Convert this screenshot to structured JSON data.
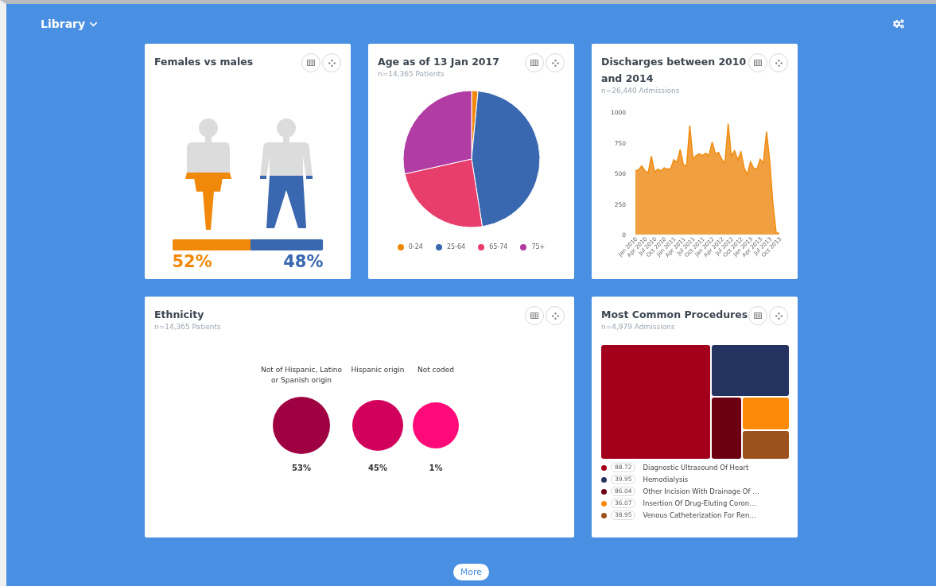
{
  "header": {
    "title": "Library"
  },
  "gender": {
    "title": "Females vs males",
    "groups": [
      {
        "kind": "female",
        "percent": "52%",
        "level": 0.52,
        "color": "#f0880a"
      },
      {
        "kind": "male",
        "percent": "48%",
        "level": 0.48,
        "color": "#3a68b0"
      }
    ]
  },
  "age": {
    "title": "Age as of 13 Jan 2017",
    "subtitle": "n=14,365 Patients",
    "chart_data": {
      "type": "pie",
      "categories": [
        "0-24",
        "25-64",
        "65-74",
        "75+"
      ],
      "series": [
        {
          "values": [
            1.5,
            46,
            24,
            28.5
          ]
        }
      ],
      "colors": [
        "#f0880a",
        "#3a68b0",
        "#e83e6c",
        "#b03ca4"
      ]
    }
  },
  "discharges": {
    "title": "Discharges between 2010 and 2014",
    "subtitle": "n=26,440 Admissions",
    "chart_data": {
      "type": "area",
      "categories": [
        "Jan 2010",
        null,
        null,
        "Apr 2010",
        null,
        null,
        "Jul 2010",
        null,
        null,
        "Oct 2010",
        null,
        null,
        "Jan 2011",
        null,
        null,
        "Apr 2011",
        null,
        null,
        "Jul 2011",
        null,
        null,
        "Oct 2011",
        null,
        null,
        "Jan 2012",
        null,
        null,
        "Apr 2012",
        null,
        null,
        "Jul 2012",
        null,
        null,
        "Oct 2012",
        null,
        null,
        "Jan 2013",
        null,
        null,
        "Apr 2013",
        null,
        null,
        "Jul 2013",
        null,
        null,
        "Oct 2013"
      ],
      "series": [
        {
          "color": "#f0a040",
          "values": [
            520,
            530,
            560,
            520,
            505,
            640,
            510,
            535,
            520,
            545,
            535,
            535,
            610,
            590,
            695,
            570,
            560,
            890,
            620,
            645,
            660,
            645,
            665,
            645,
            755,
            660,
            670,
            615,
            585,
            905,
            640,
            685,
            610,
            675,
            545,
            490,
            595,
            540,
            535,
            615,
            585,
            840,
            600,
            250,
            15,
            10
          ]
        }
      ],
      "ylim": [
        0,
        1000
      ],
      "yticks": [
        0,
        250,
        500,
        750,
        1000
      ]
    }
  },
  "ethnicity": {
    "title": "Ethnicity",
    "subtitle": "n=14,365 Patients",
    "groups": [
      {
        "label": "Not of Hispanic, Latino or Spanish origin",
        "percent": "53%",
        "color": "#9e0042"
      },
      {
        "label": "Hispanic origin",
        "percent": "45%",
        "color": "#d0005c"
      },
      {
        "label": "Not coded",
        "percent": "1%",
        "color": "#ff0a78"
      }
    ]
  },
  "procedures": {
    "title": "Most Common Procedures",
    "subtitle": "n=4,979 Admissions",
    "items": [
      {
        "value": "88.72",
        "label": "Diagnostic Ultrasound Of Heart",
        "color": "#a3001c"
      },
      {
        "value": "39.95",
        "label": "Hemodialysis",
        "color": "#253360"
      },
      {
        "value": "86.04",
        "label": "Other Incision With Drainage Of …",
        "color": "#6b0012"
      },
      {
        "value": "36.07",
        "label": "Insertion Of Drug-Eluting Coron…",
        "color": "#ff8a0a"
      },
      {
        "value": "38.95",
        "label": "Venous Catheterization For Ren…",
        "color": "#9c521c"
      }
    ]
  },
  "more_button": "More"
}
